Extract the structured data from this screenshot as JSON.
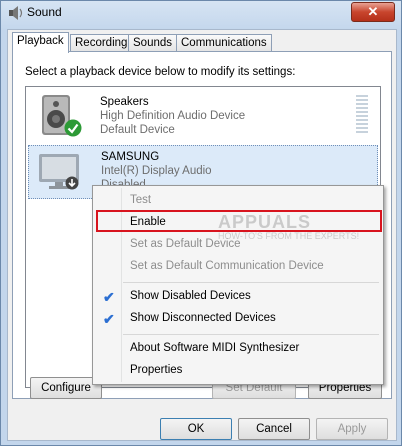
{
  "window": {
    "title": "Sound",
    "close_label": "✕"
  },
  "tabs": [
    {
      "label": "Playback",
      "active": true
    },
    {
      "label": "Recording",
      "active": false
    },
    {
      "label": "Sounds",
      "active": false
    },
    {
      "label": "Communications",
      "active": false
    }
  ],
  "instructions": "Select a playback device below to modify its settings:",
  "devices": [
    {
      "name": "Speakers",
      "driver": "High Definition Audio Device",
      "status": "Default Device",
      "icon": "speaker-icon",
      "badge": "green-check-icon"
    },
    {
      "name": "SAMSUNG",
      "driver": "Intel(R) Display Audio",
      "status": "Disabled",
      "icon": "monitor-icon",
      "badge": "disabled-arrow-icon"
    }
  ],
  "buttons": {
    "configure": "Configure",
    "set_default": "Set Default",
    "properties": "Properties",
    "ok": "OK",
    "cancel": "Cancel",
    "apply": "Apply"
  },
  "context_menu": {
    "items": [
      {
        "label": "Test",
        "enabled": false,
        "checked": false
      },
      {
        "label": "Enable",
        "enabled": true,
        "checked": false
      },
      {
        "label": "Set as Default Device",
        "enabled": false,
        "checked": false
      },
      {
        "label": "Set as Default Communication Device",
        "enabled": false,
        "checked": false
      },
      {
        "label": "Show Disabled Devices",
        "enabled": true,
        "checked": true
      },
      {
        "label": "Show Disconnected Devices",
        "enabled": true,
        "checked": true
      },
      {
        "label": "About Software MIDI Synthesizer",
        "enabled": true,
        "checked": false
      },
      {
        "label": "Properties",
        "enabled": true,
        "checked": false
      }
    ]
  },
  "watermark": {
    "main": "APPUALS",
    "sub": "HOW-TO'S FROM THE EXPERTS!"
  },
  "colors": {
    "highlight": "#d8141e",
    "check": "#2c6fd2",
    "selection": "#dceaf9"
  }
}
